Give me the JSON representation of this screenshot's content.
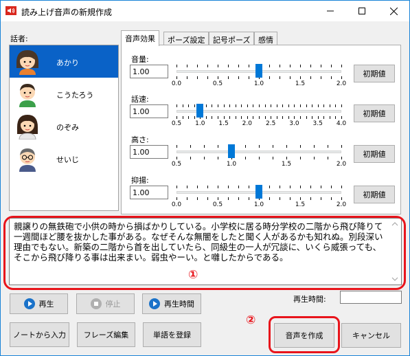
{
  "window": {
    "title": "読み上げ音声の新規作成"
  },
  "speakers": {
    "label": "話者:",
    "items": [
      {
        "name": "あかり",
        "selected": true
      },
      {
        "name": "こうたろう",
        "selected": false
      },
      {
        "name": "のぞみ",
        "selected": false
      },
      {
        "name": "せいじ",
        "selected": false
      }
    ]
  },
  "tabs": [
    "音声効果",
    "ポーズ設定",
    "記号ポーズ",
    "感情"
  ],
  "active_tab": "音声効果",
  "sliders": [
    {
      "label": "音量:",
      "value": "1.00",
      "min": 0.0,
      "max": 2.0,
      "current": 1.0,
      "tick_labels": [
        "0.0",
        "0.5",
        "1.0",
        "1.5",
        "2.0"
      ]
    },
    {
      "label": "話速:",
      "value": "1.00",
      "min": 0.5,
      "max": 4.0,
      "current": 1.0,
      "tick_labels": [
        "0.5",
        "1.0",
        "1.5",
        "2.0",
        "2.5",
        "3.0",
        "3.5",
        "4.0"
      ]
    },
    {
      "label": "高さ:",
      "value": "1.00",
      "min": 0.5,
      "max": 2.0,
      "current": 1.0,
      "tick_labels": [
        "0.5",
        "1.0",
        "1.5",
        "2.0"
      ]
    },
    {
      "label": "抑揚:",
      "value": "1.00",
      "min": 0.0,
      "max": 2.0,
      "current": 1.0,
      "tick_labels": [
        "0.0",
        "0.5",
        "1.0",
        "1.5",
        "2.0"
      ]
    }
  ],
  "reset_label": "初期値",
  "text_content": "親譲りの無鉄砲で小供の時から損ばかりしている。小学校に居る時分学校の二階から飛び降りて一週間ほど腰を抜かした事がある。なぜそんな無闇をしたと聞く人があるかも知れぬ。別段深い理由でもない。新築の二階から首を出していたら、同級生の一人が冗談に、いくら威張っても、そこから飛び降りる事は出来まい。弱虫やーい。と囃したからである。",
  "markers": {
    "one": "①",
    "two": "②"
  },
  "playback": {
    "play": "再生",
    "stop": "停止",
    "play_time_button": "再生時間",
    "play_time_label": "再生時間:"
  },
  "bottom_buttons": {
    "from_note": "ノートから入力",
    "phrase_edit": "フレーズ編集",
    "register_word": "単語を登録",
    "create": "音声を作成",
    "cancel": "キャンセル"
  },
  "colors": {
    "selection": "#0a62c7",
    "slider_thumb": "#0078d7",
    "annotation_red": "#e8141b"
  },
  "icons": {
    "play": "play-icon",
    "stop": "stop-icon",
    "clock": "clock-play-icon"
  }
}
